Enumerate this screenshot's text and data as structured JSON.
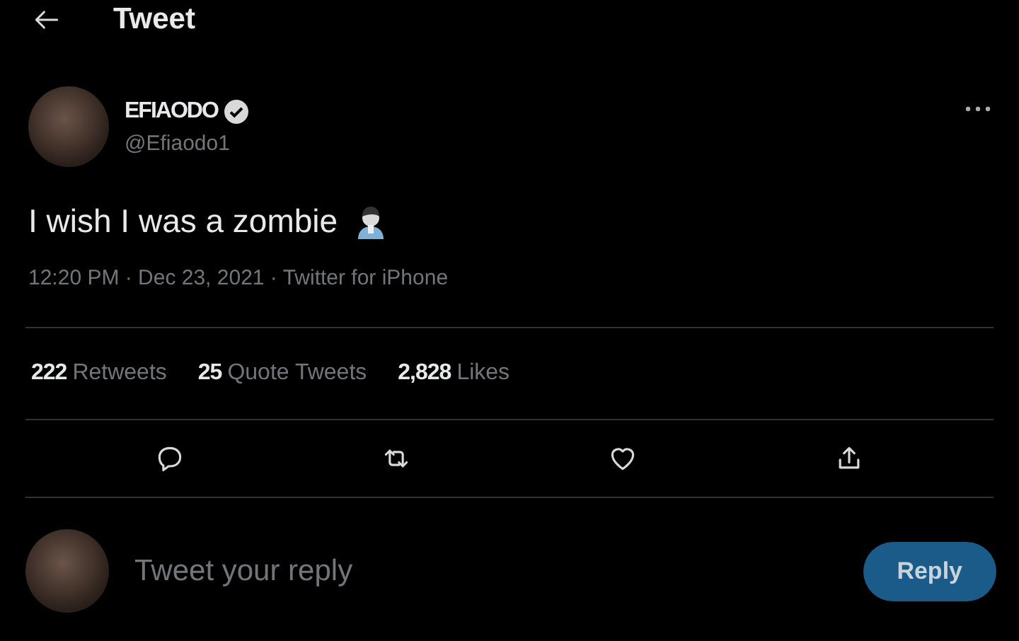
{
  "header": {
    "title": "Tweet"
  },
  "author": {
    "name": "EFIAODO",
    "verified": true,
    "handle": "@Efiaodo1"
  },
  "tweet": {
    "text": "I wish I was a zombie",
    "meta": "12:20 PM · Dec 23, 2021 · Twitter for iPhone"
  },
  "stats": [
    {
      "count": "222",
      "label": "Retweets"
    },
    {
      "count": "25",
      "label": "Quote Tweets"
    },
    {
      "count": "2,828",
      "label": "Likes"
    }
  ],
  "reply": {
    "placeholder": "Tweet your reply",
    "button": "Reply"
  }
}
